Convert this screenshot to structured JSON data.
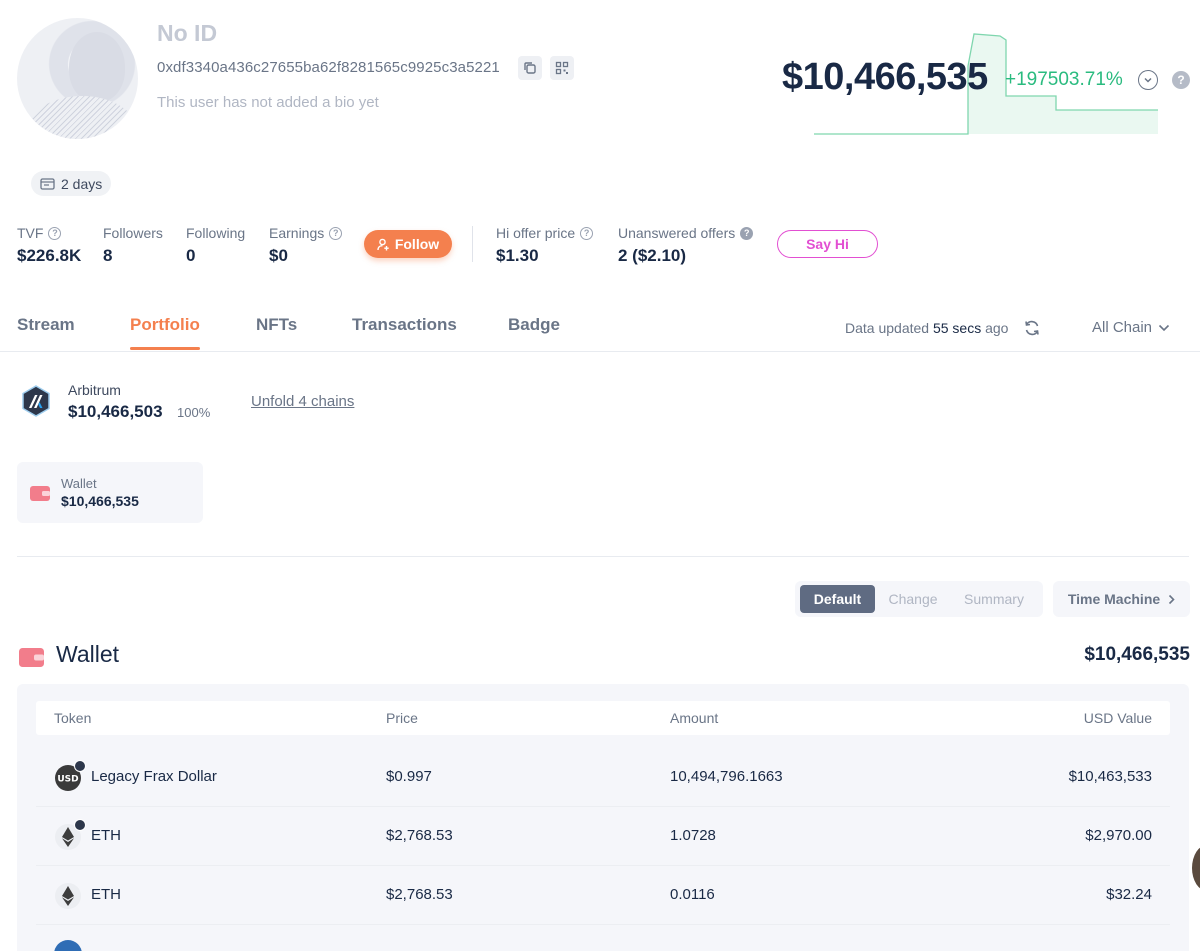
{
  "profile": {
    "name": "No ID",
    "address": "0xdf3340a436c27655ba62f8281565c9925c3a5221",
    "bio": "This user has not added a bio yet",
    "age": "2 days"
  },
  "net_worth": {
    "value": "$10,466,535",
    "change_pct": "+197503.71%",
    "help": "?"
  },
  "stats": {
    "tvf": {
      "label": "TVF",
      "value": "$226.8K"
    },
    "followers": {
      "label": "Followers",
      "value": "8"
    },
    "following": {
      "label": "Following",
      "value": "0"
    },
    "earnings": {
      "label": "Earnings",
      "value": "$0"
    },
    "follow_label": "Follow",
    "hi_offer": {
      "label": "Hi offer price",
      "value": "$1.30"
    },
    "unanswered": {
      "label": "Unanswered offers",
      "value": "2 ($2.10)"
    },
    "sayhi_label": "Say Hi"
  },
  "tabs": [
    "Stream",
    "Portfolio",
    "NFTs",
    "Transactions",
    "Badge"
  ],
  "active_tab": "Portfolio",
  "updated": {
    "prefix": "Data updated",
    "time": "55 secs",
    "suffix": "ago"
  },
  "chain_filter": "All Chain",
  "chain": {
    "name": "Arbitrum",
    "value": "$10,466,503",
    "pct": "100%",
    "unfold_label": "Unfold 4 chains"
  },
  "wallet_card": {
    "label": "Wallet",
    "value": "$10,466,535"
  },
  "views": {
    "default": "Default",
    "change": "Change",
    "summary": "Summary",
    "time_machine": "Time Machine"
  },
  "wallet_section": {
    "title": "Wallet",
    "total": "$10,466,535"
  },
  "table": {
    "headers": {
      "token": "Token",
      "price": "Price",
      "amount": "Amount",
      "usd_value": "USD Value"
    },
    "rows": [
      {
        "token": "Legacy Frax Dollar",
        "price": "$0.997",
        "amount": "10,494,796.1663",
        "usd_value": "$10,463,533",
        "icon": "usd-icon",
        "icon_text": "USD"
      },
      {
        "token": "ETH",
        "price": "$2,768.53",
        "amount": "1.0728",
        "usd_value": "$2,970.00",
        "icon": "eth-icon"
      },
      {
        "token": "ETH",
        "price": "$2,768.53",
        "amount": "0.0116",
        "usd_value": "$32.24",
        "icon": "eth-icon"
      }
    ]
  },
  "colors": {
    "accent": "#f4804e",
    "positive": "#2abb7f",
    "sayhi": "#e24fd2",
    "text": "#192945",
    "muted": "#6a7587"
  }
}
